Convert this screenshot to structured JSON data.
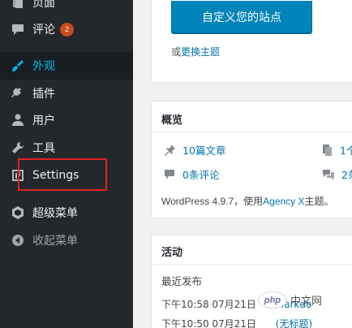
{
  "sidebar": {
    "items": [
      {
        "label": "页面",
        "icon": "pages-icon"
      },
      {
        "label": "评论",
        "icon": "comments-icon",
        "badge": "2"
      },
      {
        "label": "外观",
        "icon": "appearance-icon",
        "current": true
      },
      {
        "label": "插件",
        "icon": "plugins-icon"
      },
      {
        "label": "用户",
        "icon": "users-icon"
      },
      {
        "label": "工具",
        "icon": "tools-icon"
      },
      {
        "label": "Settings",
        "icon": "settings-icon"
      },
      {
        "label": "超级菜单",
        "icon": "mega-menu-icon"
      },
      {
        "label": "收起菜单",
        "icon": "collapse-icon"
      }
    ],
    "highlight_color": "#e0221f",
    "current_color": "#00b9eb"
  },
  "welcome": {
    "customize_button": "自定义您的站点",
    "change_prefix": "或",
    "change_link": "更换主题"
  },
  "at_a_glance": {
    "title": "概览",
    "posts": "10篇文章",
    "pages": "1个",
    "comments": "0条评论",
    "pending": "2条",
    "wp_prefix": "WordPress 4.9.7，使用",
    "theme": "Agency X",
    "wp_suffix": "主题。"
  },
  "activity": {
    "title": "活动",
    "recently_published": "最近发布",
    "rows": [
      {
        "time": "下午10:58 07月21日",
        "link": "Markdo"
      },
      {
        "time": "下午10:50 07月21日",
        "link": "(无标题)"
      }
    ]
  },
  "watermark": {
    "logo": "php",
    "text": "中文网"
  }
}
